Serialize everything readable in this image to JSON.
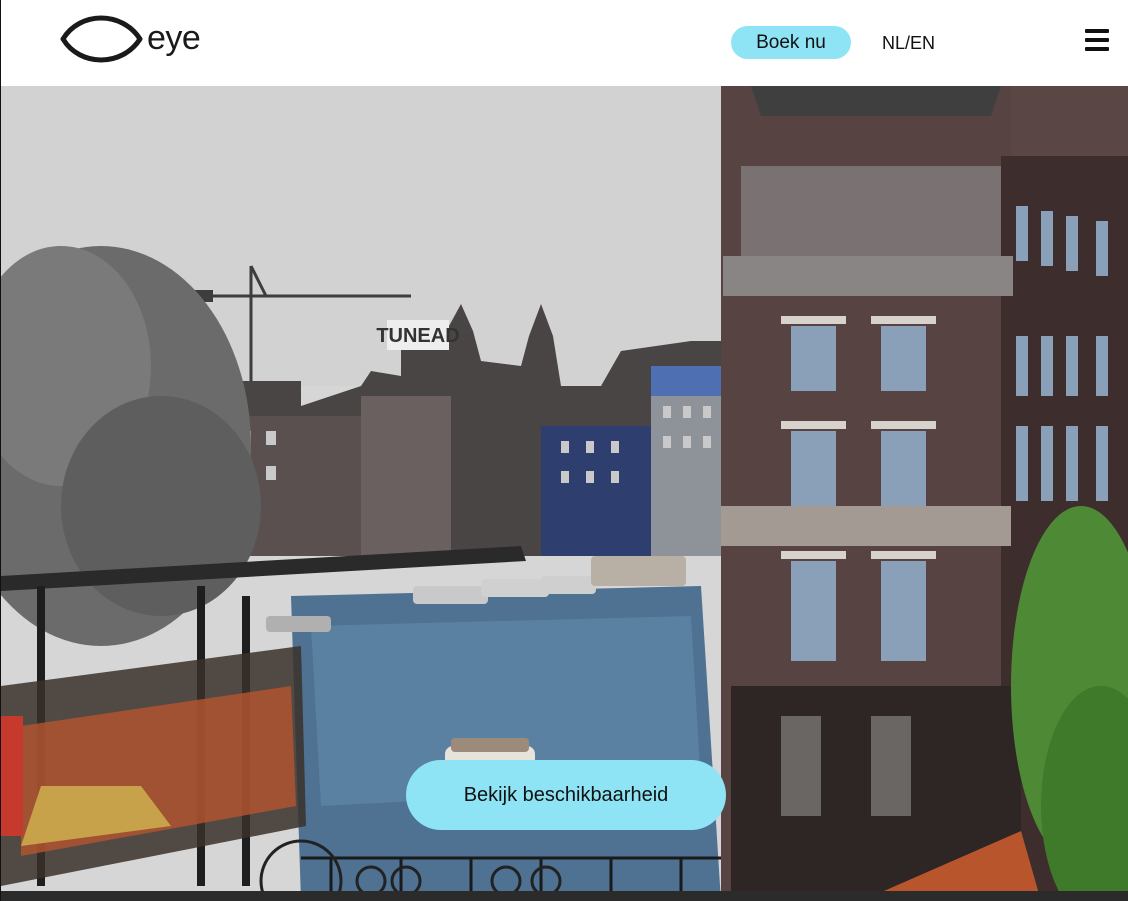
{
  "header": {
    "logo_text": "eye",
    "book_label": "Boek nu",
    "lang_nl": "NL",
    "lang_sep": "/",
    "lang_en": "EN",
    "menu_icon": "hamburger-icon"
  },
  "hero": {
    "image_icon": "amsterdam-canal-photo",
    "sign_text": "TUNEAD",
    "cta_label": "Bekijk beschikbaarheid"
  },
  "colors": {
    "accent": "#8ee4f5",
    "text": "#111111",
    "background": "#ffffff"
  }
}
